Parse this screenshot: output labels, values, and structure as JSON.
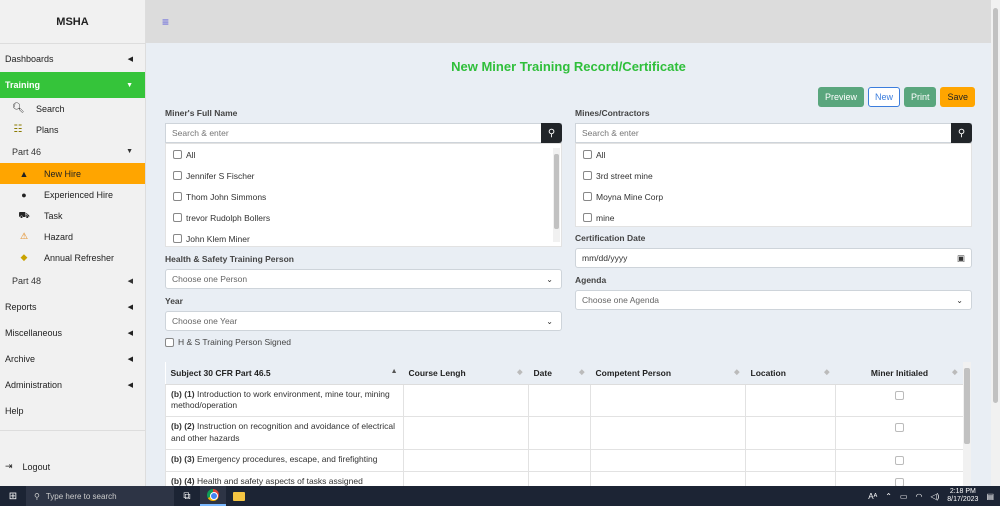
{
  "brand": "MSHA",
  "sidebar": {
    "dashboards": "Dashboards",
    "training": "Training",
    "search": "Search",
    "plans": "Plans",
    "part46": "Part 46",
    "new_hire": "New Hire",
    "experienced_hire": "Experienced Hire",
    "task": "Task",
    "hazard": "Hazard",
    "annual_refresher": "Annual Refresher",
    "part48": "Part 48",
    "reports": "Reports",
    "miscellaneous": "Miscellaneous",
    "archive": "Archive",
    "administration": "Administration",
    "help": "Help",
    "logout": "Logout"
  },
  "page": {
    "title": "New Miner Training Record/Certificate",
    "buttons": {
      "preview": "Preview",
      "new": "New",
      "print": "Print",
      "save": "Save"
    }
  },
  "form": {
    "miners_label": "Miner's Full Name",
    "miners_placeholder": "Search & enter",
    "miners": [
      "All",
      "Jennifer S Fischer",
      "Thom John Simmons",
      "trevor Rudolph Bollers",
      "John Klem Miner"
    ],
    "mines_label": "Mines/Contractors",
    "mines_placeholder": "Search & enter",
    "mines": [
      "All",
      "3rd street mine",
      "Moyna Mine Corp",
      "mine"
    ],
    "hs_label": "Health & Safety Training Person",
    "hs_placeholder": "Choose one Person",
    "year_label": "Year",
    "year_placeholder": "Choose one Year",
    "signed_label": "H & S Training Person Signed",
    "cert_label": "Certification Date",
    "cert_placeholder": "mm/dd/yyyy",
    "agenda_label": "Agenda",
    "agenda_placeholder": "Choose one Agenda"
  },
  "table": {
    "headers": [
      "Subject 30 CFR Part 46.5",
      "Course Lengh",
      "Date",
      "Competent Person",
      "Location",
      "Miner Initialed"
    ],
    "rows": [
      {
        "code": "(b) (1)",
        "text": " Introduction to work environment, mine tour, mining method/operation"
      },
      {
        "code": "(b) (2)",
        "text": " Instruction on recognition and avoidance of electrical and other hazards"
      },
      {
        "code": "(b) (3)",
        "text": " Emergency procedures, escape, and firefighting"
      },
      {
        "code": "(b) (4)",
        "text": " Health and safety aspects of tasks assigned"
      }
    ]
  },
  "taskbar": {
    "search_placeholder": "Type here to search",
    "time": "2:18 PM",
    "date": "8/17/2023"
  }
}
